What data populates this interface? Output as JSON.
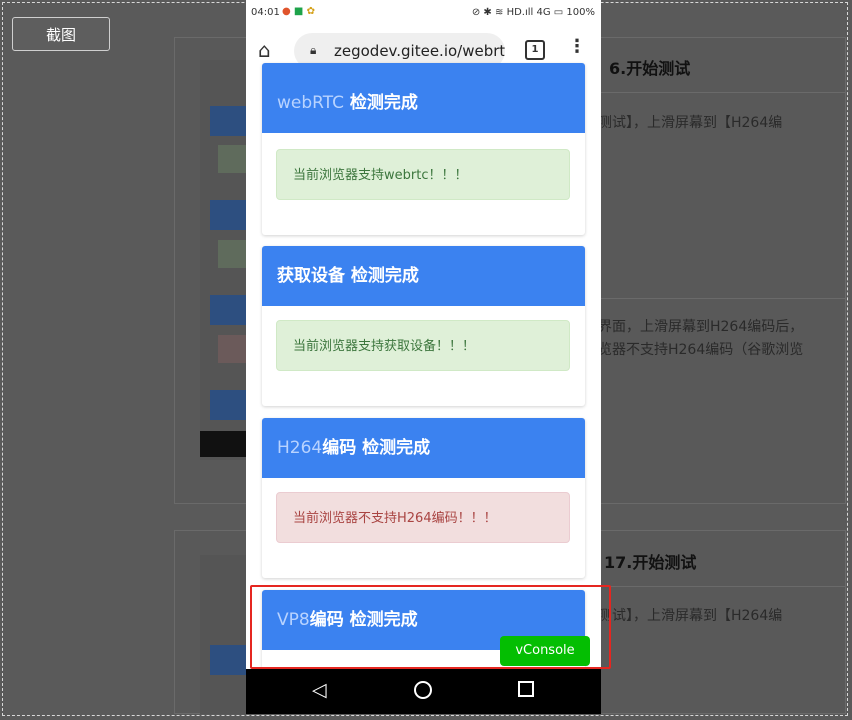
{
  "capture_button": "截图",
  "background": {
    "step6_title": "6.开始测试",
    "step6_text": "测试】，上滑屏幕到【H264编",
    "middle_text_line1": "界面，上滑屏幕到H264编码后，",
    "middle_text_line2": "览器不支持H264编码（谷歌浏览",
    "step7_title": "17.开始测试",
    "step7_text": "测试】，上滑屏幕到【H264编"
  },
  "phone": {
    "status": {
      "time": "04:01",
      "right": "HD.ıll 4G ▭ 100%"
    },
    "browser": {
      "url": "zegodev.gitee.io/webrtc",
      "tab_count": "1"
    },
    "cards": [
      {
        "head_light": "webRTC",
        "head_bold": " 检测完成",
        "alert": "当前浏览器支持webrtc！！！",
        "status": "ok"
      },
      {
        "head_light": "",
        "head_bold": "获取设备 检测完成",
        "alert": "当前浏览器支持获取设备！！！",
        "status": "ok"
      },
      {
        "head_light": "H264",
        "head_bold": "编码 检测完成",
        "alert": "当前浏览器不支持H264编码！！！",
        "status": "bad"
      },
      {
        "head_light": "VP8",
        "head_bold": "编码 检测完成"
      }
    ],
    "vconsole": "vConsole"
  },
  "colors": {
    "card_header": "#3b82f0",
    "success_bg": "#dff0d8",
    "error_bg": "#f2dede",
    "vconsole": "#04be02",
    "highlight": "#e52620"
  }
}
